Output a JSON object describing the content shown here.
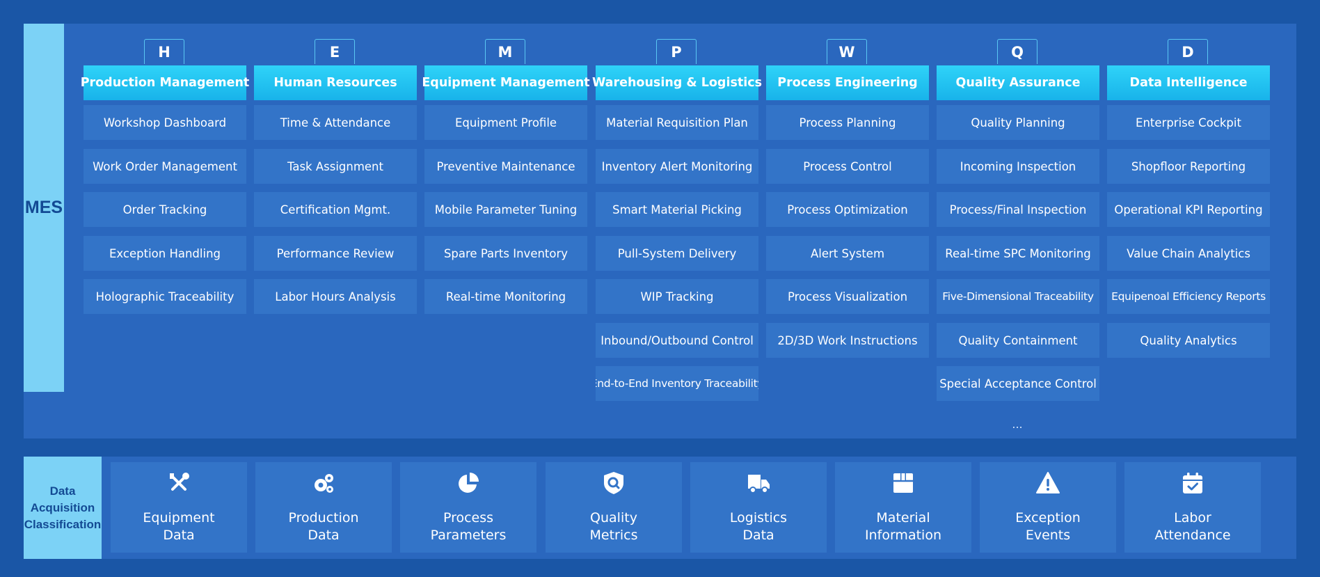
{
  "mes_label": "MES",
  "columns": [
    {
      "letter": "H",
      "title": "Production Management",
      "items": [
        "Workshop Dashboard",
        "Work Order Management",
        "Order Tracking",
        "Exception Handling",
        "Holographic Traceability"
      ]
    },
    {
      "letter": "E",
      "title": "Human Resources",
      "items": [
        "Time & Attendance",
        "Task Assignment",
        "Certification Mgmt.",
        "Performance Review",
        "Labor Hours Analysis"
      ]
    },
    {
      "letter": "M",
      "title": "Equipment Management",
      "items": [
        "Equipment Profile",
        "Preventive Maintenance",
        "Mobile Parameter Tuning",
        "Spare Parts Inventory",
        "Real-time Monitoring"
      ]
    },
    {
      "letter": "P",
      "title": "Warehousing & Logistics",
      "items": [
        "Material Requisition Plan",
        "Inventory Alert Monitoring",
        "Smart Material Picking",
        "Pull-System Delivery",
        "WIP Tracking",
        "Inbound/Outbound Control",
        "End-to-End Inventory Traceability"
      ]
    },
    {
      "letter": "W",
      "title": "Process Engineering",
      "items": [
        "Process Planning",
        "Process Control",
        "Process Optimization",
        "Alert System",
        "Process Visualization",
        "2D/3D Work Instructions"
      ]
    },
    {
      "letter": "Q",
      "title": "Quality Assurance",
      "items": [
        "Quality Planning",
        "Incoming Inspection",
        "Process/Final Inspection",
        "Real-time SPC Monitoring",
        "Five-Dimensional Traceability",
        "Quality Containment",
        "Special Acceptance Control"
      ]
    },
    {
      "letter": "D",
      "title": "Data Intelligence",
      "items": [
        "Enterprise Cockpit",
        "Shopfloor Reporting",
        "Operational KPI Reporting",
        "Value Chain Analytics",
        "Equipenoal Efficiency Reports",
        "Quality Analytics"
      ]
    }
  ],
  "more_indicator": "...",
  "daq_label_lines": [
    "Data",
    "Acquisition",
    "Classification"
  ],
  "categories": [
    {
      "icon": "tools-icon",
      "lines": [
        "Equipment",
        "Data"
      ]
    },
    {
      "icon": "gears-icon",
      "lines": [
        "Production",
        "Data"
      ]
    },
    {
      "icon": "pie-chart-icon",
      "lines": [
        "Process",
        "Parameters"
      ]
    },
    {
      "icon": "shield-search-icon",
      "lines": [
        "Quality",
        "Metrics"
      ]
    },
    {
      "icon": "truck-icon",
      "lines": [
        "Logistics",
        "Data"
      ]
    },
    {
      "icon": "box-icon",
      "lines": [
        "Material",
        "Information"
      ]
    },
    {
      "icon": "warning-icon",
      "lines": [
        "Exception",
        "Events"
      ]
    },
    {
      "icon": "calendar-check-icon",
      "lines": [
        "Labor",
        "Attendance"
      ]
    }
  ],
  "colors": {
    "accent": "#1fc2f1",
    "side": "#7cd2f6",
    "panel": "#2a67be",
    "cell": "#3374c8",
    "background": "#1a56a6"
  }
}
